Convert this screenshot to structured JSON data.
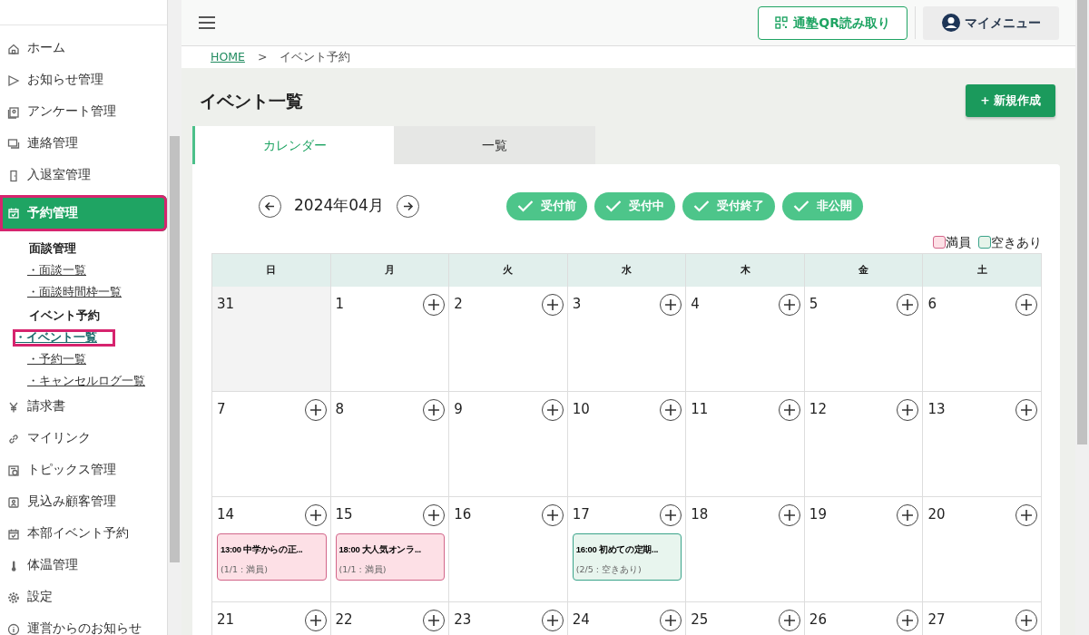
{
  "sidebar": {
    "items": [
      {
        "label": "ホーム",
        "selected": false
      },
      {
        "label": "お知らせ管理",
        "selected": false
      },
      {
        "label": "アンケート管理",
        "selected": false
      },
      {
        "label": "連絡管理",
        "selected": false
      },
      {
        "label": "入退室管理",
        "selected": false
      },
      {
        "label": "予約管理",
        "selected": true,
        "highlighted": true,
        "children": [
          {
            "heading": "面談管理",
            "links": [
              {
                "label": "・面談一覧",
                "selected": false,
                "highlighted": false
              },
              {
                "label": "・面談時間枠一覧",
                "selected": false,
                "highlighted": false
              }
            ]
          },
          {
            "heading": "イベント予約",
            "links": [
              {
                "label": "・イベント一覧",
                "selected": true,
                "highlighted": true
              },
              {
                "label": "・予約一覧",
                "selected": false,
                "highlighted": false
              },
              {
                "label": "・キャンセルログ一覧",
                "selected": false,
                "highlighted": false
              }
            ]
          }
        ]
      },
      {
        "label": "請求書",
        "selected": false
      },
      {
        "label": "マイリンク",
        "selected": false
      },
      {
        "label": "トピックス管理",
        "selected": false
      },
      {
        "label": "見込み顧客管理",
        "selected": false
      },
      {
        "label": "本部イベント予約",
        "selected": false
      },
      {
        "label": "体温管理",
        "selected": false
      },
      {
        "label": "設定",
        "selected": false
      },
      {
        "label": "運営からのお知らせ",
        "selected": false
      }
    ]
  },
  "header": {
    "qr_button": "通塾QR読み取り",
    "my_menu": "マイメニュー"
  },
  "breadcrumb": [
    "HOME",
    ">",
    "イベント予約"
  ],
  "page_title": "イベント一覧",
  "new_button": "+ 新規作成",
  "tabs": [
    {
      "label": "カレンダー",
      "selected": true
    },
    {
      "label": "一覧",
      "selected": false
    }
  ],
  "calendar": {
    "month": "2024年04月",
    "filters": [
      {
        "label": "受付前",
        "checked": true
      },
      {
        "label": "受付中",
        "checked": true
      },
      {
        "label": "受付終了",
        "checked": true
      },
      {
        "label": "非公開",
        "checked": true
      }
    ],
    "legend": [
      {
        "label": "満員",
        "color": "#fde0e6"
      },
      {
        "label": "空きあり",
        "color": "#e6f4ea"
      }
    ],
    "weekdays": [
      "日",
      "月",
      "火",
      "水",
      "木",
      "金",
      "土"
    ],
    "weeks": [
      [
        {
          "day": "31",
          "other_month": true
        },
        {
          "day": "1",
          "other_month": false
        },
        {
          "day": "2",
          "other_month": false
        },
        {
          "day": "3",
          "other_month": false
        },
        {
          "day": "4",
          "other_month": false
        },
        {
          "day": "5",
          "other_month": false
        },
        {
          "day": "6",
          "other_month": false
        }
      ],
      [
        {
          "day": "7",
          "other_month": false
        },
        {
          "day": "8",
          "other_month": false
        },
        {
          "day": "9",
          "other_month": false
        },
        {
          "day": "10",
          "other_month": false
        },
        {
          "day": "11",
          "other_month": false
        },
        {
          "day": "12",
          "other_month": false
        },
        {
          "day": "13",
          "other_month": false
        }
      ],
      [
        {
          "day": "14",
          "other_month": false,
          "events": [
            {
              "title": "13:00 中学からの正...",
              "info": "(1/1 : 満員)",
              "kind": "full"
            }
          ]
        },
        {
          "day": "15",
          "other_month": false,
          "events": [
            {
              "title": "18:00 大人気オンラ...",
              "info": "(1/1 : 満員)",
              "kind": "full"
            }
          ]
        },
        {
          "day": "16",
          "other_month": false
        },
        {
          "day": "17",
          "other_month": false,
          "events": [
            {
              "title": "16:00 初めての定期...",
              "info": "(2/5 : 空きあり)",
              "kind": "available"
            }
          ]
        },
        {
          "day": "18",
          "other_month": false
        },
        {
          "day": "19",
          "other_month": false
        },
        {
          "day": "20",
          "other_month": false
        }
      ],
      [
        {
          "day": "21",
          "other_month": false
        },
        {
          "day": "22",
          "other_month": false
        },
        {
          "day": "23",
          "other_month": false
        },
        {
          "day": "24",
          "other_month": false
        },
        {
          "day": "25",
          "other_month": false
        },
        {
          "day": "26",
          "other_month": false
        },
        {
          "day": "27",
          "other_month": false
        }
      ]
    ]
  }
}
